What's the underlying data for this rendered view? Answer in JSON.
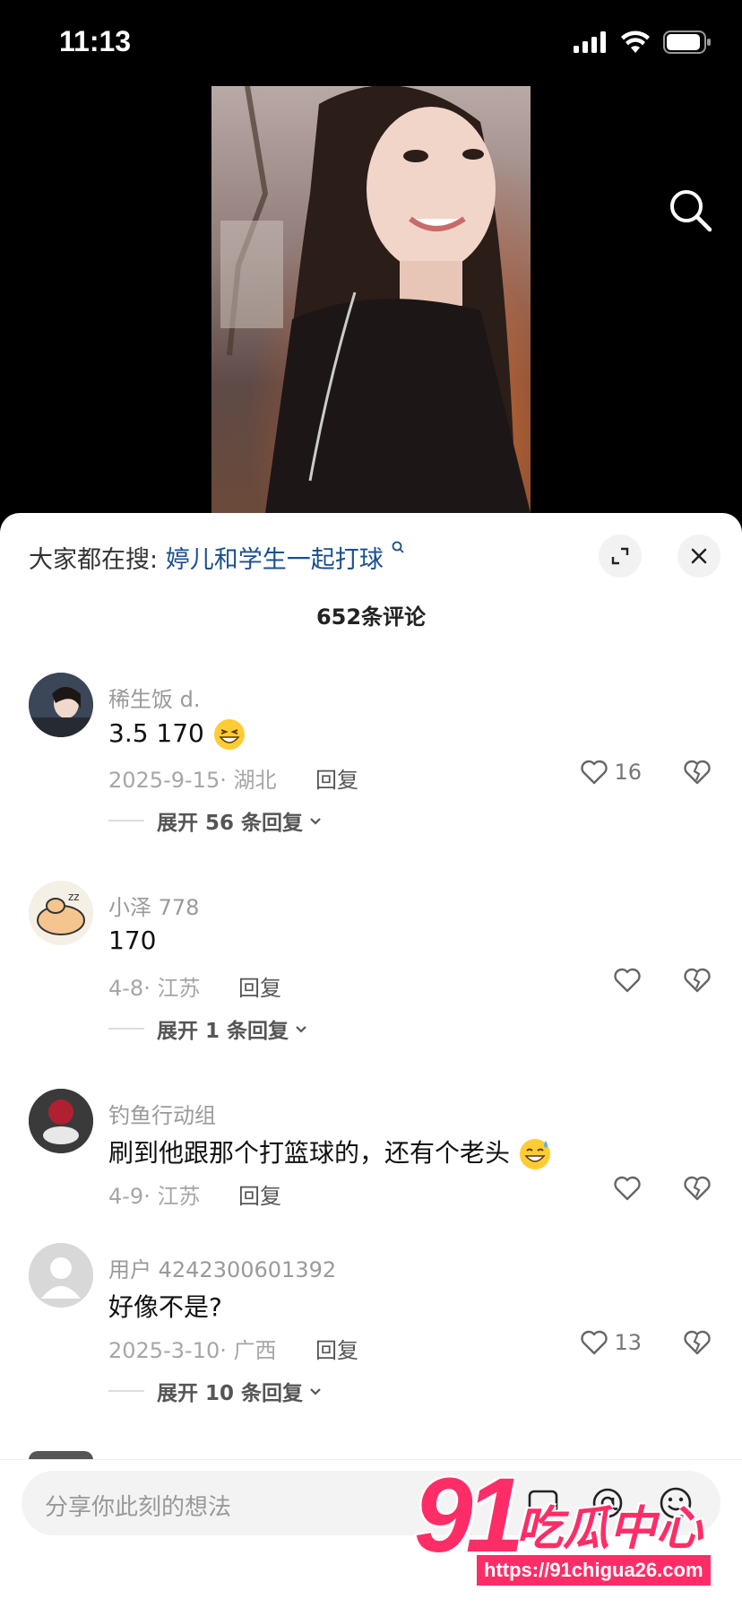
{
  "status_bar": {
    "time": "11:13"
  },
  "sheet": {
    "hot_search_prefix": "大家都在搜:",
    "hot_search_keyword": "婷儿和学生一起打球",
    "comment_count": "652条评论"
  },
  "comments": [
    {
      "name": "稀生饭 d.",
      "text": "3.5 170",
      "date": "2025-9-15· 湖北",
      "reply": "回复",
      "likes": "16",
      "expand": "展开 56 条回复"
    },
    {
      "name": "小泽 778",
      "text": "170",
      "date": "4-8· 江苏",
      "reply": "回复",
      "likes": "",
      "expand": "展开 1 条回复"
    },
    {
      "name": "钓鱼行动组",
      "text": "刷到他跟那个打篮球的，还有个老头",
      "date": "4-9· 江苏",
      "reply": "回复",
      "likes": ""
    },
    {
      "name": "用户 4242300601392",
      "text": "好像不是?",
      "date": "2025-3-10· 广西",
      "reply": "回复",
      "likes": "13",
      "expand": "展开 10 条回复"
    }
  ],
  "input": {
    "placeholder": "分享你此刻的想法"
  },
  "watermark": {
    "logo_number": "91",
    "logo_text": "吃瓜中心",
    "url": "https://91chigua26.com"
  },
  "colors": {
    "keyword": "#1a4f8f",
    "watermark": "#ff2d67",
    "sheet_bg": "#ffffff"
  },
  "icons": [
    "signal-icon",
    "wifi-icon",
    "battery-icon",
    "search-icon",
    "expand-icon",
    "close-icon",
    "heart-icon",
    "broken-heart-icon",
    "chevron-down-icon",
    "at-icon",
    "emoji-icon"
  ]
}
